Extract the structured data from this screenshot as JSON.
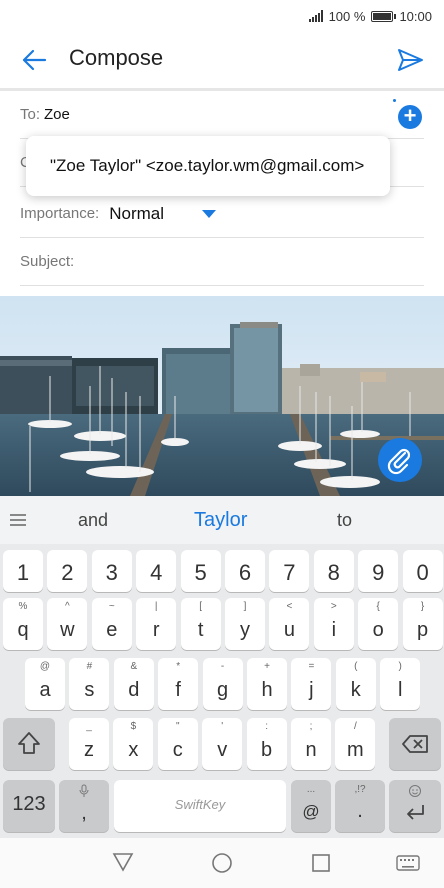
{
  "status_bar": {
    "battery_text": "100 %",
    "battery_level": 1.0,
    "time": "10:00"
  },
  "header": {
    "title": "Compose",
    "back_icon": "arrow-left-icon",
    "send_icon": "send-icon"
  },
  "compose": {
    "to_label": "To:",
    "to_value": "Zoe",
    "cc_partial": "C",
    "importance_label": "Importance:",
    "importance_value": "Normal",
    "subject_label": "Subject:",
    "subject_value": ""
  },
  "suggestion_popup": {
    "text": "\"Zoe Taylor\" <zoe.taylor.wm@gmail.com>"
  },
  "attachment": {
    "icon": "paperclip-icon"
  },
  "keyboard": {
    "suggestions": [
      "and",
      "Taylor",
      "to"
    ],
    "number_row": [
      "1",
      "2",
      "3",
      "4",
      "5",
      "6",
      "7",
      "8",
      "9",
      "0"
    ],
    "row1": [
      {
        "k": "q",
        "s": "%"
      },
      {
        "k": "w",
        "s": "^"
      },
      {
        "k": "e",
        "s": "~"
      },
      {
        "k": "r",
        "s": "|"
      },
      {
        "k": "t",
        "s": "["
      },
      {
        "k": "y",
        "s": "]"
      },
      {
        "k": "u",
        "s": "<"
      },
      {
        "k": "i",
        "s": ">"
      },
      {
        "k": "o",
        "s": "{"
      },
      {
        "k": "p",
        "s": "}"
      }
    ],
    "row2": [
      {
        "k": "a",
        "s": "@"
      },
      {
        "k": "s",
        "s": "#"
      },
      {
        "k": "d",
        "s": "&"
      },
      {
        "k": "f",
        "s": "*"
      },
      {
        "k": "g",
        "s": "-"
      },
      {
        "k": "h",
        "s": "+"
      },
      {
        "k": "j",
        "s": "="
      },
      {
        "k": "k",
        "s": "("
      },
      {
        "k": "l",
        "s": ")"
      }
    ],
    "row3": [
      {
        "k": "z",
        "s": "_"
      },
      {
        "k": "x",
        "s": "$"
      },
      {
        "k": "c",
        "s": "\""
      },
      {
        "k": "v",
        "s": "'"
      },
      {
        "k": "b",
        "s": ":"
      },
      {
        "k": "n",
        "s": ";"
      },
      {
        "k": "m",
        "s": "/"
      }
    ],
    "symbols_key": "123",
    "comma_key": ",",
    "space_brand": "SwiftKey",
    "at_key": "@",
    "period_key": ".",
    "period_sub": ",!?",
    "at_sub": "..."
  },
  "nav_bar": {
    "back": "triangle-back-icon",
    "home": "circle-home-icon",
    "recents": "square-recents-icon",
    "keyboard": "keyboard-icon"
  },
  "colors": {
    "accent": "#1a7ae0"
  }
}
